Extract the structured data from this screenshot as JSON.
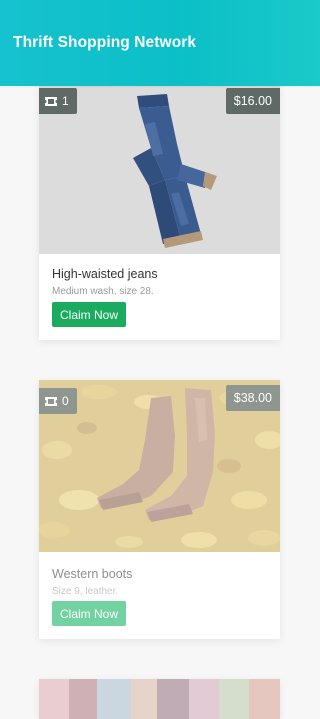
{
  "header": {
    "title": "Thrift Shopping Network"
  },
  "items": [
    {
      "tickets": "1",
      "price": "$16.00",
      "title": "High-waisted jeans",
      "description": "Medium wash, size 28.",
      "claim_label": "Claim Now",
      "photo_icon": "jeans-photo"
    },
    {
      "tickets": "0",
      "price": "$38.00",
      "title": "Western boots",
      "description": "Size 9, leather.",
      "claim_label": "Claim Now",
      "photo_icon": "boots-photo"
    }
  ],
  "colors": {
    "header_gradient_start": "#16c2cf",
    "header_gradient_end": "#1ac9c9",
    "claim_button": "#1aab5f",
    "badge": "#5f6a66"
  }
}
